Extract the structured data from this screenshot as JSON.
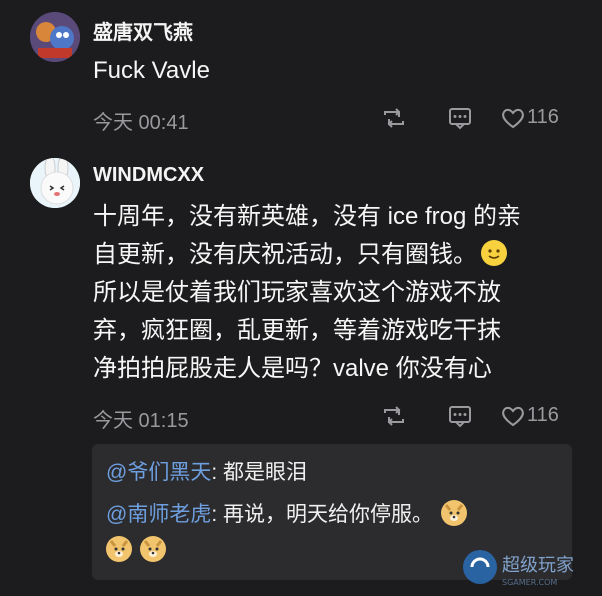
{
  "posts": [
    {
      "username": "盛唐双飞燕",
      "text": "Fuck Vavle",
      "time": "今天 00:41",
      "likes": "116"
    },
    {
      "username": "WINDMCXX",
      "lines": [
        "十周年，没有新英雄，没有 ice frog 的亲",
        "自更新，没有庆祝活动，只有圈钱。",
        "所以是仗着我们玩家喜欢这个游戏不放",
        "弃，疯狂圈，乱更新，等着游戏吃干抹",
        "净拍拍屁股走人是吗？valve 你没有心"
      ],
      "time": "今天 01:15",
      "likes": "116"
    }
  ],
  "replies": [
    {
      "mention": "@爷们黑天",
      "text": ": 都是眼泪"
    },
    {
      "mention": "@南师老虎",
      "text": ": 再说，明天给你停服。"
    }
  ],
  "icons": {
    "retweet": "retweet-icon",
    "comment": "comment-icon",
    "like": "heart-icon",
    "smile": "smile-emoji",
    "doge": "doge-emoji"
  },
  "colors": {
    "background": "#1c1c1e",
    "reply_box": "#2c2c2e",
    "mention": "#6e9fe0",
    "meta": "#9a9a9e"
  },
  "watermark": {
    "text": "超级玩家"
  }
}
